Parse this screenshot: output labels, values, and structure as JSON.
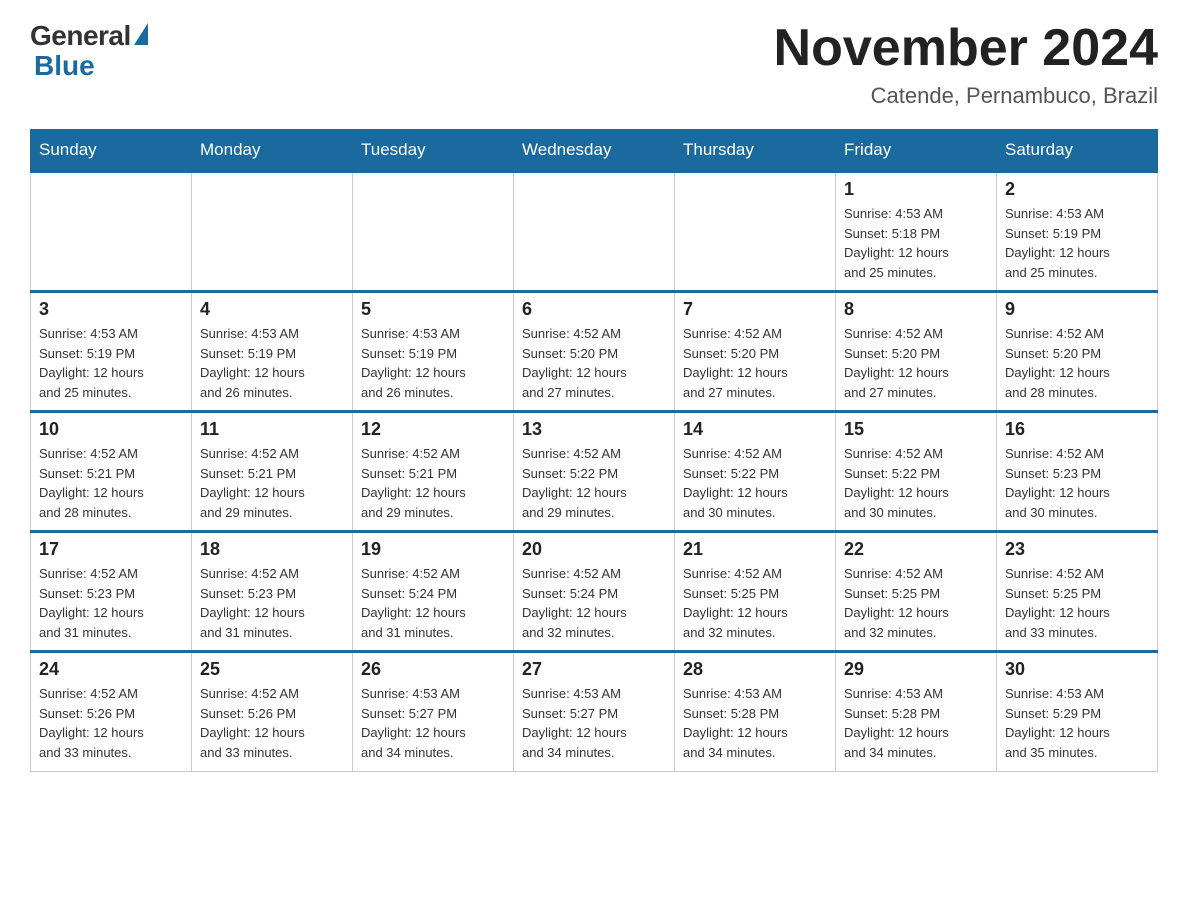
{
  "logo": {
    "general": "General",
    "blue": "Blue"
  },
  "header": {
    "month": "November 2024",
    "location": "Catende, Pernambuco, Brazil"
  },
  "weekdays": [
    "Sunday",
    "Monday",
    "Tuesday",
    "Wednesday",
    "Thursday",
    "Friday",
    "Saturday"
  ],
  "weeks": [
    [
      {
        "day": "",
        "info": ""
      },
      {
        "day": "",
        "info": ""
      },
      {
        "day": "",
        "info": ""
      },
      {
        "day": "",
        "info": ""
      },
      {
        "day": "",
        "info": ""
      },
      {
        "day": "1",
        "info": "Sunrise: 4:53 AM\nSunset: 5:18 PM\nDaylight: 12 hours\nand 25 minutes."
      },
      {
        "day": "2",
        "info": "Sunrise: 4:53 AM\nSunset: 5:19 PM\nDaylight: 12 hours\nand 25 minutes."
      }
    ],
    [
      {
        "day": "3",
        "info": "Sunrise: 4:53 AM\nSunset: 5:19 PM\nDaylight: 12 hours\nand 25 minutes."
      },
      {
        "day": "4",
        "info": "Sunrise: 4:53 AM\nSunset: 5:19 PM\nDaylight: 12 hours\nand 26 minutes."
      },
      {
        "day": "5",
        "info": "Sunrise: 4:53 AM\nSunset: 5:19 PM\nDaylight: 12 hours\nand 26 minutes."
      },
      {
        "day": "6",
        "info": "Sunrise: 4:52 AM\nSunset: 5:20 PM\nDaylight: 12 hours\nand 27 minutes."
      },
      {
        "day": "7",
        "info": "Sunrise: 4:52 AM\nSunset: 5:20 PM\nDaylight: 12 hours\nand 27 minutes."
      },
      {
        "day": "8",
        "info": "Sunrise: 4:52 AM\nSunset: 5:20 PM\nDaylight: 12 hours\nand 27 minutes."
      },
      {
        "day": "9",
        "info": "Sunrise: 4:52 AM\nSunset: 5:20 PM\nDaylight: 12 hours\nand 28 minutes."
      }
    ],
    [
      {
        "day": "10",
        "info": "Sunrise: 4:52 AM\nSunset: 5:21 PM\nDaylight: 12 hours\nand 28 minutes."
      },
      {
        "day": "11",
        "info": "Sunrise: 4:52 AM\nSunset: 5:21 PM\nDaylight: 12 hours\nand 29 minutes."
      },
      {
        "day": "12",
        "info": "Sunrise: 4:52 AM\nSunset: 5:21 PM\nDaylight: 12 hours\nand 29 minutes."
      },
      {
        "day": "13",
        "info": "Sunrise: 4:52 AM\nSunset: 5:22 PM\nDaylight: 12 hours\nand 29 minutes."
      },
      {
        "day": "14",
        "info": "Sunrise: 4:52 AM\nSunset: 5:22 PM\nDaylight: 12 hours\nand 30 minutes."
      },
      {
        "day": "15",
        "info": "Sunrise: 4:52 AM\nSunset: 5:22 PM\nDaylight: 12 hours\nand 30 minutes."
      },
      {
        "day": "16",
        "info": "Sunrise: 4:52 AM\nSunset: 5:23 PM\nDaylight: 12 hours\nand 30 minutes."
      }
    ],
    [
      {
        "day": "17",
        "info": "Sunrise: 4:52 AM\nSunset: 5:23 PM\nDaylight: 12 hours\nand 31 minutes."
      },
      {
        "day": "18",
        "info": "Sunrise: 4:52 AM\nSunset: 5:23 PM\nDaylight: 12 hours\nand 31 minutes."
      },
      {
        "day": "19",
        "info": "Sunrise: 4:52 AM\nSunset: 5:24 PM\nDaylight: 12 hours\nand 31 minutes."
      },
      {
        "day": "20",
        "info": "Sunrise: 4:52 AM\nSunset: 5:24 PM\nDaylight: 12 hours\nand 32 minutes."
      },
      {
        "day": "21",
        "info": "Sunrise: 4:52 AM\nSunset: 5:25 PM\nDaylight: 12 hours\nand 32 minutes."
      },
      {
        "day": "22",
        "info": "Sunrise: 4:52 AM\nSunset: 5:25 PM\nDaylight: 12 hours\nand 32 minutes."
      },
      {
        "day": "23",
        "info": "Sunrise: 4:52 AM\nSunset: 5:25 PM\nDaylight: 12 hours\nand 33 minutes."
      }
    ],
    [
      {
        "day": "24",
        "info": "Sunrise: 4:52 AM\nSunset: 5:26 PM\nDaylight: 12 hours\nand 33 minutes."
      },
      {
        "day": "25",
        "info": "Sunrise: 4:52 AM\nSunset: 5:26 PM\nDaylight: 12 hours\nand 33 minutes."
      },
      {
        "day": "26",
        "info": "Sunrise: 4:53 AM\nSunset: 5:27 PM\nDaylight: 12 hours\nand 34 minutes."
      },
      {
        "day": "27",
        "info": "Sunrise: 4:53 AM\nSunset: 5:27 PM\nDaylight: 12 hours\nand 34 minutes."
      },
      {
        "day": "28",
        "info": "Sunrise: 4:53 AM\nSunset: 5:28 PM\nDaylight: 12 hours\nand 34 minutes."
      },
      {
        "day": "29",
        "info": "Sunrise: 4:53 AM\nSunset: 5:28 PM\nDaylight: 12 hours\nand 34 minutes."
      },
      {
        "day": "30",
        "info": "Sunrise: 4:53 AM\nSunset: 5:29 PM\nDaylight: 12 hours\nand 35 minutes."
      }
    ]
  ]
}
